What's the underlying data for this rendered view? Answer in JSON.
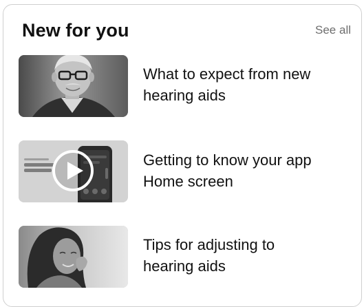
{
  "section": {
    "title": "New for you",
    "see_all_label": "See all"
  },
  "items": [
    {
      "title_line1": "What to expect from new",
      "title_line2": "hearing aids",
      "thumbnail": "older-man-with-glasses-photo"
    },
    {
      "title_line1": "Getting to know your app",
      "title_line2": "Home screen",
      "thumbnail": "app-home-screen-video",
      "thumbnail_text": "Getting to know your app Home screen",
      "play_icon": "play-icon"
    },
    {
      "title_line1": "Tips for adjusting to",
      "title_line2": "hearing aids",
      "thumbnail": "woman-touching-ear-photo"
    }
  ]
}
